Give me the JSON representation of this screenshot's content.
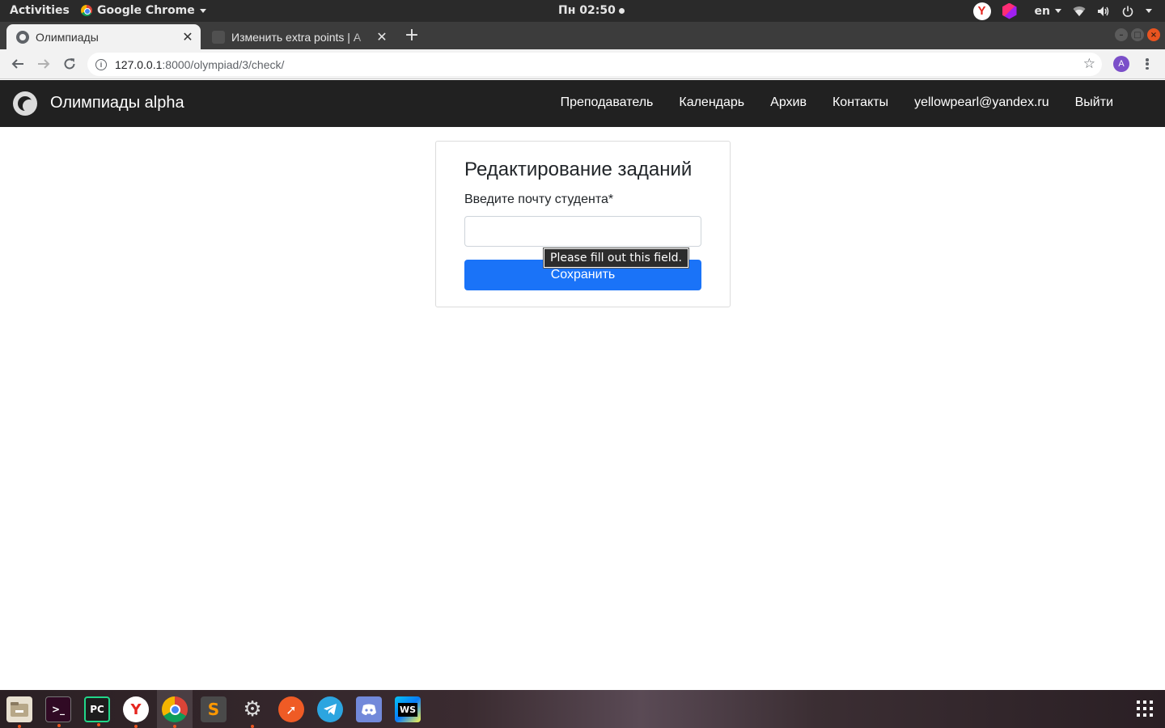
{
  "topbar": {
    "activities": "Activities",
    "app_name": "Google Chrome",
    "clock": "Пн 02:50",
    "lang": "en"
  },
  "tabs": [
    {
      "title": "Олимпиады",
      "active": true
    },
    {
      "title": "Изменить extra points | А",
      "active": false
    }
  ],
  "address_bar": {
    "host": "127.0.0.1",
    "path": ":8000/olympiad/3/check/"
  },
  "profile_initial": "A",
  "site": {
    "brand": "Олимпиады alpha",
    "nav": [
      "Преподаватель",
      "Календарь",
      "Архив",
      "Контакты",
      "yellowpearl@yandex.ru",
      "Выйти"
    ]
  },
  "form": {
    "title": "Редактирование заданий",
    "email_label": "Введите почту студента*",
    "email_value": "",
    "save_label": "Сохранить",
    "validation_tooltip": "Please fill out this field."
  },
  "dock": {
    "items": [
      "files",
      "terminal",
      "pycharm",
      "yandex-browser",
      "chrome",
      "sublime-text",
      "settings",
      "postman",
      "telegram",
      "discord",
      "webstorm"
    ]
  },
  "colors": {
    "site_nav_bg": "#212121",
    "primary_button": "#1a73f8",
    "ubuntu_orange": "#e95420"
  }
}
